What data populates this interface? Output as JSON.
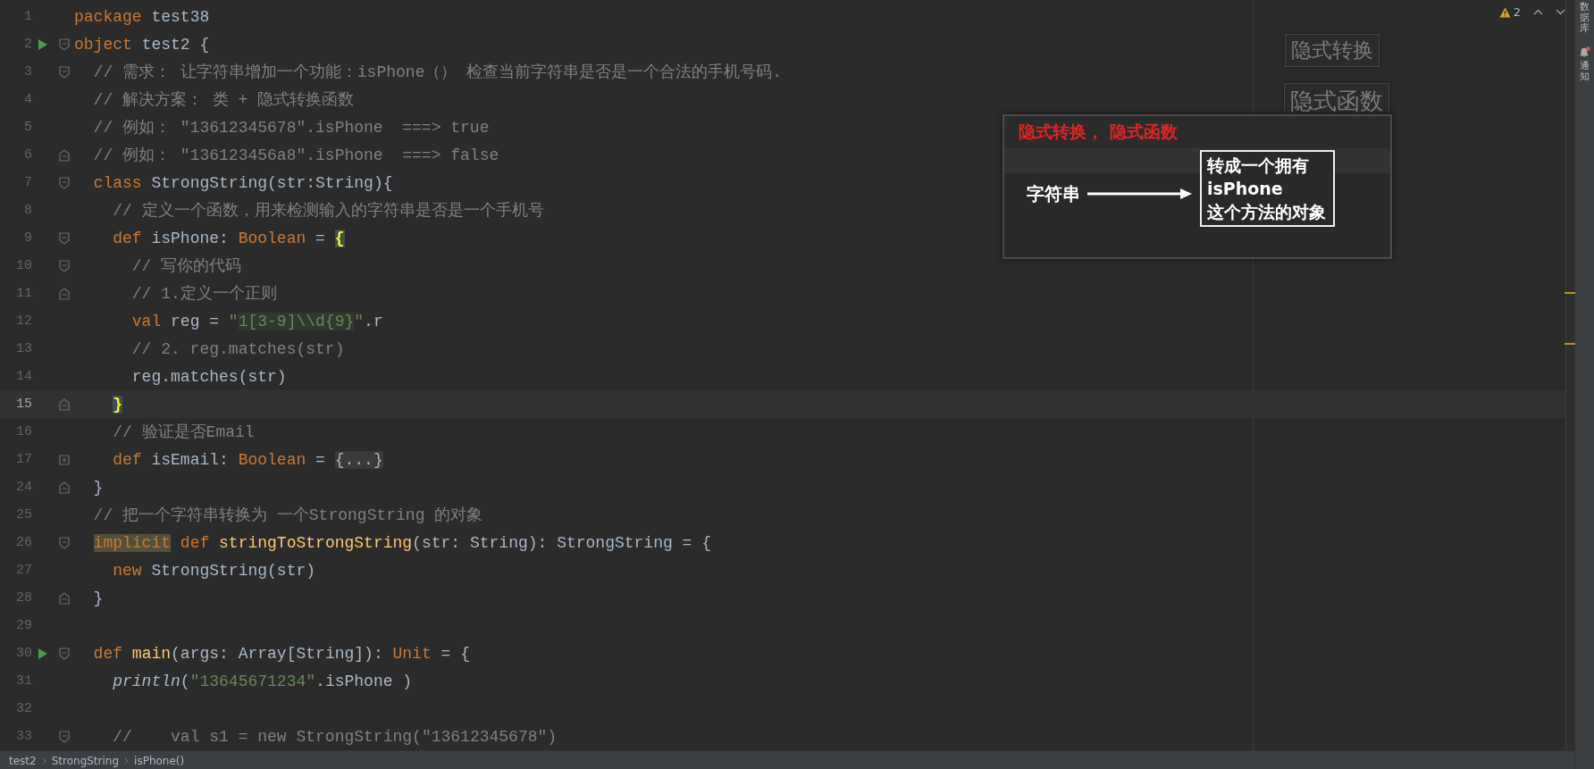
{
  "editor": {
    "lines": [
      {
        "number": "1",
        "run": false,
        "current": false,
        "tokens": [
          {
            "kind": "keyword",
            "text": "package"
          },
          {
            "kind": "plain",
            "text": " test38"
          }
        ]
      },
      {
        "number": "2",
        "run": true,
        "current": false,
        "fold_marker": {
          "kind": "start"
        },
        "tokens": [
          {
            "kind": "keyword",
            "text": "object"
          },
          {
            "kind": "plain",
            "text": " test2 {"
          }
        ]
      },
      {
        "number": "3",
        "run": false,
        "current": false,
        "fold_marker": {
          "kind": "start"
        },
        "tokens": [
          {
            "kind": "comment",
            "text": "  // 需求： 让字符串增加一个功能：isPhone（） 检查当前字符串是否是一个合法的手机号码."
          }
        ]
      },
      {
        "number": "4",
        "run": false,
        "current": false,
        "tokens": [
          {
            "kind": "comment",
            "text": "  // 解决方案： 类 + 隐式转换函数"
          }
        ]
      },
      {
        "number": "5",
        "run": false,
        "current": false,
        "tokens": [
          {
            "kind": "comment",
            "text": "  // 例如： \"13612345678\".isPhone  ===> true"
          }
        ]
      },
      {
        "number": "6",
        "run": false,
        "current": false,
        "fold_marker": {
          "kind": "end"
        },
        "tokens": [
          {
            "kind": "comment",
            "text": "  // 例如： \"136123456a8\".isPhone  ===> false"
          }
        ]
      },
      {
        "number": "7",
        "run": false,
        "current": false,
        "fold_marker": {
          "kind": "start"
        },
        "tokens": [
          {
            "kind": "keyword",
            "text": "  class"
          },
          {
            "kind": "plain",
            "text": " StrongString(str:String){"
          }
        ]
      },
      {
        "number": "8",
        "run": false,
        "current": false,
        "tokens": [
          {
            "kind": "comment",
            "text": "    // 定义一个函数，用来检测输入的字符串是否是一个手机号"
          }
        ]
      },
      {
        "number": "9",
        "run": false,
        "current": false,
        "fold_marker": {
          "kind": "start"
        },
        "tokens": [
          {
            "kind": "keyword",
            "text": "    def"
          },
          {
            "kind": "plain",
            "text": " isPhone: "
          },
          {
            "kind": "keyword",
            "text": "Boolean"
          },
          {
            "kind": "plain",
            "text": " = "
          },
          {
            "kind": "match",
            "text": "{"
          }
        ]
      },
      {
        "number": "10",
        "run": false,
        "current": false,
        "fold_marker": {
          "kind": "start"
        },
        "tokens": [
          {
            "kind": "comment",
            "text": "      // 写你的代码"
          }
        ]
      },
      {
        "number": "11",
        "run": false,
        "current": false,
        "fold_marker": {
          "kind": "end"
        },
        "tokens": [
          {
            "kind": "comment",
            "text": "      // 1.定义一个正则"
          }
        ]
      },
      {
        "number": "12",
        "run": false,
        "current": false,
        "tokens": [
          {
            "kind": "keyword",
            "text": "      val"
          },
          {
            "kind": "plain",
            "text": " reg = "
          },
          {
            "kind": "string",
            "text": "\""
          },
          {
            "kind": "regex",
            "text": "1[3-9]\\\\d{9}"
          },
          {
            "kind": "string",
            "text": "\""
          },
          {
            "kind": "plain",
            "text": ".r"
          }
        ]
      },
      {
        "number": "13",
        "run": false,
        "current": false,
        "tokens": [
          {
            "kind": "comment",
            "text": "      // 2. reg.matches(str)"
          }
        ]
      },
      {
        "number": "14",
        "run": false,
        "current": false,
        "tokens": [
          {
            "kind": "plain",
            "text": "      reg.matches(str)"
          }
        ]
      },
      {
        "number": "15",
        "run": false,
        "current": true,
        "fold_marker": {
          "kind": "end"
        },
        "tokens": [
          {
            "kind": "match",
            "text": "    }"
          }
        ]
      },
      {
        "number": "16",
        "run": false,
        "current": false,
        "tokens": [
          {
            "kind": "comment",
            "text": "    // 验证是否Email"
          }
        ]
      },
      {
        "number": "17",
        "run": false,
        "current": false,
        "fold_marker": {
          "kind": "collapsed"
        },
        "tokens": [
          {
            "kind": "keyword",
            "text": "    def"
          },
          {
            "kind": "plain",
            "text": " isEmail: "
          },
          {
            "kind": "keyword",
            "text": "Boolean"
          },
          {
            "kind": "plain",
            "text": " = "
          },
          {
            "kind": "folded",
            "text": "{...}"
          }
        ]
      },
      {
        "number": "24",
        "run": false,
        "current": false,
        "fold_marker": {
          "kind": "end"
        },
        "tokens": [
          {
            "kind": "plain",
            "text": "  }"
          }
        ]
      },
      {
        "number": "25",
        "run": false,
        "current": false,
        "tokens": [
          {
            "kind": "comment",
            "text": "  // 把一个字符串转换为 一个StrongString 的对象"
          }
        ]
      },
      {
        "number": "26",
        "run": false,
        "current": false,
        "fold_marker": {
          "kind": "start"
        },
        "tokens": [
          {
            "kind": "implicit",
            "text": "  implicit"
          },
          {
            "kind": "keyword",
            "text": " def"
          },
          {
            "kind": "function",
            "text": " stringToStrongString"
          },
          {
            "kind": "plain",
            "text": "(str: String): StrongString = {"
          }
        ]
      },
      {
        "number": "27",
        "run": false,
        "current": false,
        "tokens": [
          {
            "kind": "keyword",
            "text": "    new"
          },
          {
            "kind": "plain",
            "text": " StrongString(str)"
          }
        ]
      },
      {
        "number": "28",
        "run": false,
        "current": false,
        "fold_marker": {
          "kind": "end"
        },
        "tokens": [
          {
            "kind": "plain",
            "text": "  }"
          }
        ]
      },
      {
        "number": "29",
        "run": false,
        "current": false
      },
      {
        "number": "30",
        "run": true,
        "current": false,
        "fold_marker": {
          "kind": "start"
        },
        "tokens": [
          {
            "kind": "keyword",
            "text": "  def"
          },
          {
            "kind": "function",
            "text": " main"
          },
          {
            "kind": "plain",
            "text": "(args: Array[String]): "
          },
          {
            "kind": "keyword",
            "text": "Unit"
          },
          {
            "kind": "plain",
            "text": " = {"
          }
        ]
      },
      {
        "number": "31",
        "run": false,
        "current": false,
        "tokens": [
          {
            "kind": "italic",
            "text": "    println"
          },
          {
            "kind": "plain",
            "text": "("
          },
          {
            "kind": "string",
            "text": "\"13645671234\""
          },
          {
            "kind": "plain",
            "text": ".isPhone )"
          }
        ]
      },
      {
        "number": "32",
        "run": false,
        "current": false
      },
      {
        "number": "33",
        "run": false,
        "current": false,
        "fold_marker": {
          "kind": "start"
        },
        "tokens": [
          {
            "kind": "comment",
            "text": "    //    val s1 = new StrongString(\"13612345678\")"
          }
        ]
      }
    ],
    "warnings": "2"
  },
  "annotations": [
    "隐式转换",
    "隐式函数"
  ],
  "overlay": {
    "title": "隐式转换， 隐式函数",
    "source": "字符串",
    "target_lines": [
      "转成一个拥有",
      "isPhone",
      "这个方法的对象"
    ]
  },
  "tool_windows": [
    {
      "label": "数据库",
      "notification": false
    },
    {
      "label": "通知",
      "notification": true
    }
  ],
  "breadcrumbs": [
    "test2",
    "StrongString",
    "isPhone()"
  ]
}
